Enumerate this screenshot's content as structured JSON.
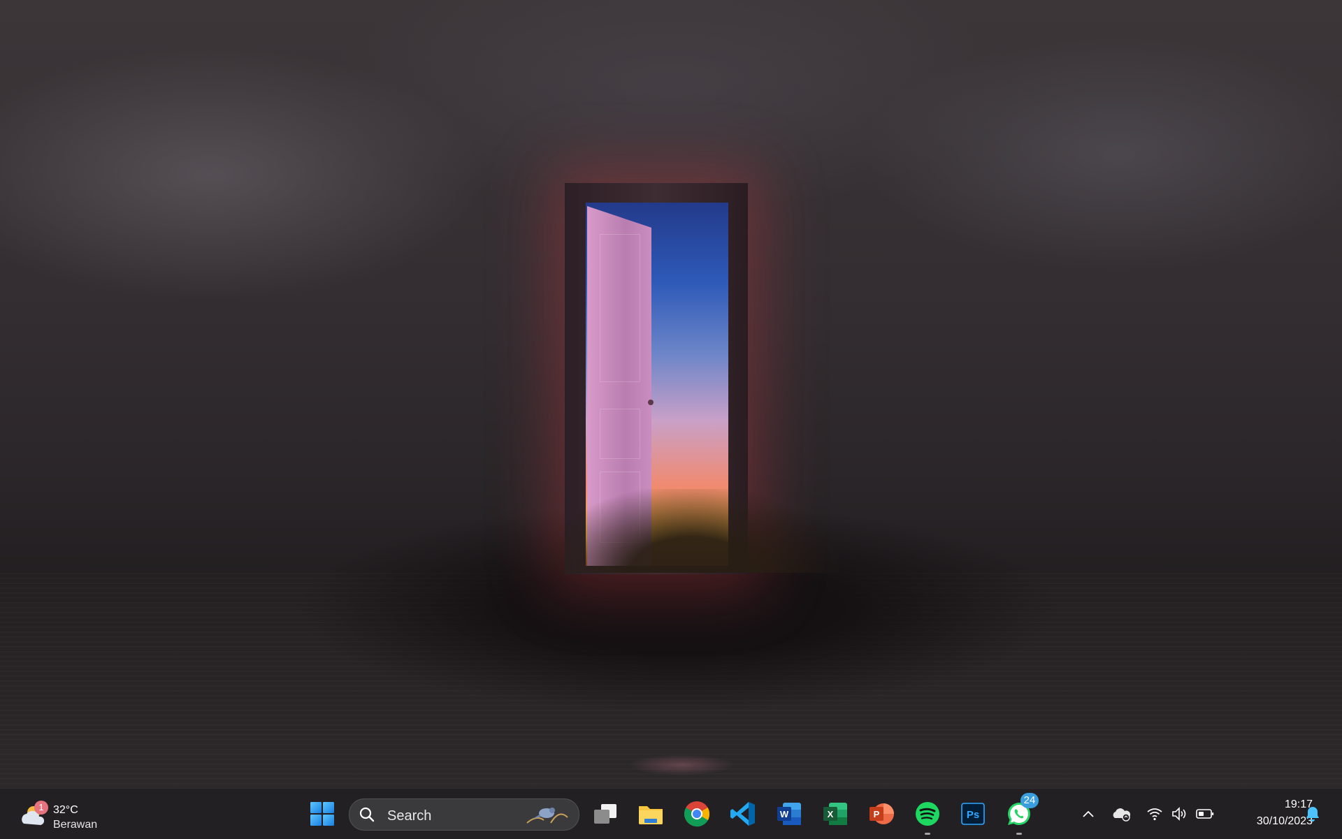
{
  "taskbar": {
    "weather": {
      "temperature": "32°C",
      "condition": "Berawan",
      "badge_count": "1",
      "icon": "partly-cloudy-icon"
    },
    "start": {
      "icon": "windows-start-icon"
    },
    "search": {
      "label": "Search",
      "icon": "search-icon"
    },
    "apps": [
      {
        "name": "Task View",
        "icon": "task-view-icon"
      },
      {
        "name": "File Explorer",
        "icon": "folder-icon"
      },
      {
        "name": "Google Chrome",
        "icon": "chrome-icon"
      },
      {
        "name": "Visual Studio Code",
        "icon": "vscode-icon"
      },
      {
        "name": "Word",
        "icon": "word-icon",
        "glyph": "W"
      },
      {
        "name": "Excel",
        "icon": "excel-icon",
        "glyph": "X"
      },
      {
        "name": "PowerPoint",
        "icon": "powerpoint-icon",
        "glyph": "P"
      },
      {
        "name": "Spotify",
        "icon": "spotify-icon"
      },
      {
        "name": "Photoshop",
        "icon": "photoshop-icon",
        "glyph": "Ps"
      },
      {
        "name": "WhatsApp",
        "icon": "whatsapp-icon",
        "badge": "24"
      }
    ],
    "tray": {
      "icons": [
        "chevron-up-icon",
        "onedrive-icon",
        "wifi-icon",
        "volume-icon",
        "battery-icon",
        "bell-icon"
      ]
    },
    "clock": {
      "time": "19:17",
      "date": "30/10/2023"
    }
  },
  "colors": {
    "taskbar_bg": "#222022",
    "accent": "#3a9dde",
    "badge_red": "#e5737d"
  }
}
